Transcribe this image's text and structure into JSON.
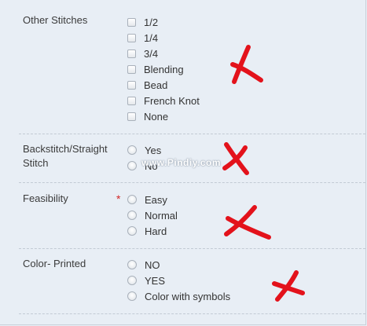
{
  "sections": {
    "other_stitches": {
      "label": "Other Stitches",
      "options": [
        "1/2",
        "1/4",
        "3/4",
        "Blending",
        "Bead",
        "French Knot",
        "None"
      ]
    },
    "backstitch": {
      "label_line1": "Backstitch/Straight",
      "label_line2": "Stitch",
      "options": [
        "Yes",
        "No"
      ]
    },
    "feasibility": {
      "label": "Feasibility",
      "required_marker": "*",
      "options": [
        "Easy",
        "Normal",
        "Hard"
      ]
    },
    "color_printed": {
      "label": "Color- Printed",
      "options": [
        "NO",
        "YES",
        "Color with symbols"
      ]
    }
  },
  "watermark": "www.Pindiy.com",
  "annotation_color": "#e3121b",
  "icons": {
    "checkbox": "checkbox-unchecked",
    "radio": "radio-unselected",
    "annotation": "red-x-mark"
  }
}
